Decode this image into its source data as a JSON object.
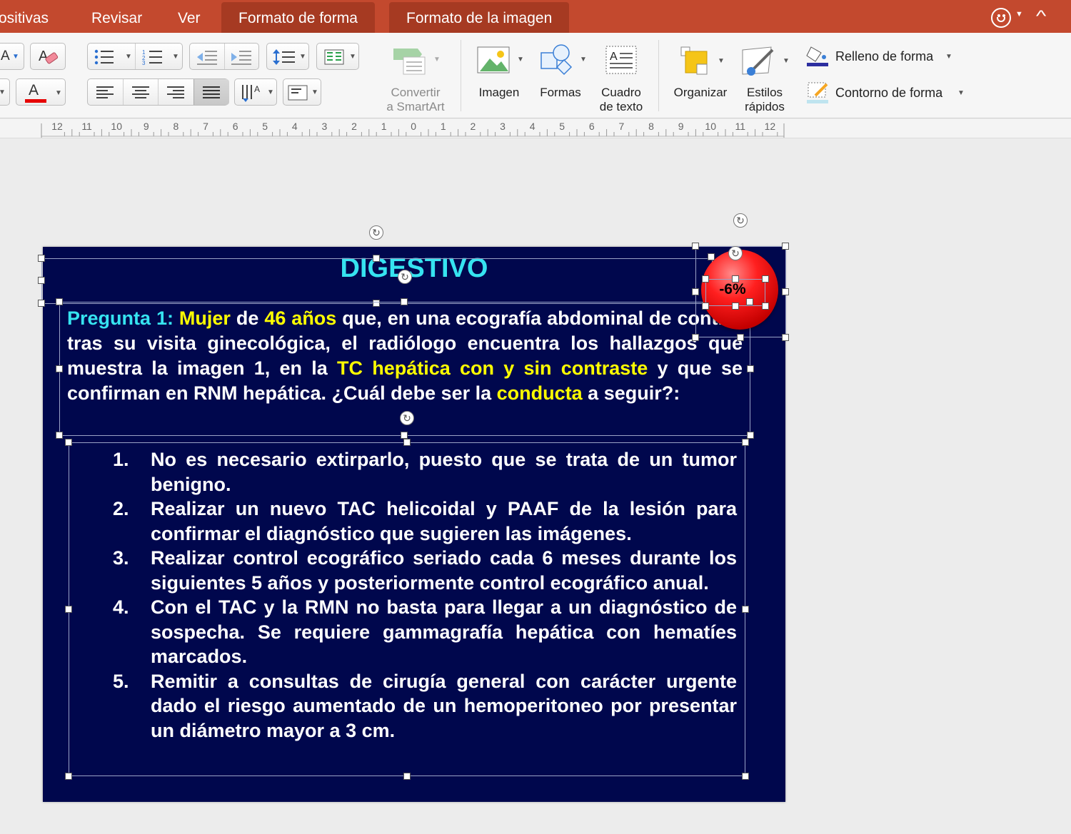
{
  "tabs": [
    {
      "label": "ositivas",
      "active": false
    },
    {
      "label": "Revisar",
      "active": false
    },
    {
      "label": "Ver",
      "active": false
    },
    {
      "label": "Formato de forma",
      "active": true
    },
    {
      "label": "Formato de la imagen",
      "active": true
    }
  ],
  "ribbon": {
    "convert_smartart": [
      "Convertir",
      "a SmartArt"
    ],
    "image_label": "Imagen",
    "shapes_label": "Formas",
    "textbox_label": [
      "Cuadro",
      "de texto"
    ],
    "arrange_label": "Organizar",
    "quick_styles_label": [
      "Estilos",
      "rápidos"
    ],
    "shape_fill_label": "Relleno de forma",
    "shape_outline_label": "Contorno de forma",
    "font_color": "#e60000",
    "accent": "#c3492e"
  },
  "ruler": {
    "labels": [
      "12",
      "11",
      "10",
      "9",
      "8",
      "7",
      "6",
      "5",
      "4",
      "3",
      "2",
      "1",
      "0",
      "1",
      "2",
      "3",
      "4",
      "5",
      "6",
      "7",
      "8",
      "9",
      "10",
      "11",
      "12"
    ]
  },
  "slide": {
    "title": "DIGESTIVO",
    "badge": "-6%",
    "question": {
      "label": "Pregunta 1:",
      "w1": "Mujer",
      "t1": " de ",
      "w2": "46 años",
      "t2": " que, en una ecografía abdominal de control tras su visita ginecológica, el radiólogo encuentra los hallazgos que muestra la imagen 1, en la ",
      "w3": "TC hepática con y sin contraste",
      "t3": " y que se confirman en RNM hepática. ¿Cuál debe ser la ",
      "w4": "conducta",
      "t4": " a seguir?:"
    },
    "answers": [
      {
        "num": "1.",
        "text": "No es necesario extirparlo, puesto que se trata de un tumor benigno."
      },
      {
        "num": "2.",
        "text": "Realizar un nuevo TAC helicoidal y PAAF de la lesión para confirmar el diagnóstico que sugieren las imágenes."
      },
      {
        "num": "3.",
        "text": "Realizar control ecográfico seriado cada 6 meses durante los siguientes 5 años y posteriormente control ecográfico anual."
      },
      {
        "num": "4.",
        "text": "Con el TAC y la RMN no basta para llegar a un diagnóstico de sospecha. Se requiere gammagrafía hepática con hematíes marcados."
      },
      {
        "num": "5.",
        "text": "Remitir a consultas de cirugía general con carácter urgente dado el riesgo aumentado de un hemoperitoneo por presentar un diámetro mayor a 3 cm."
      }
    ],
    "colors": {
      "background": "#00074d",
      "title": "#36e3f0",
      "highlight": "#ffff00"
    }
  }
}
